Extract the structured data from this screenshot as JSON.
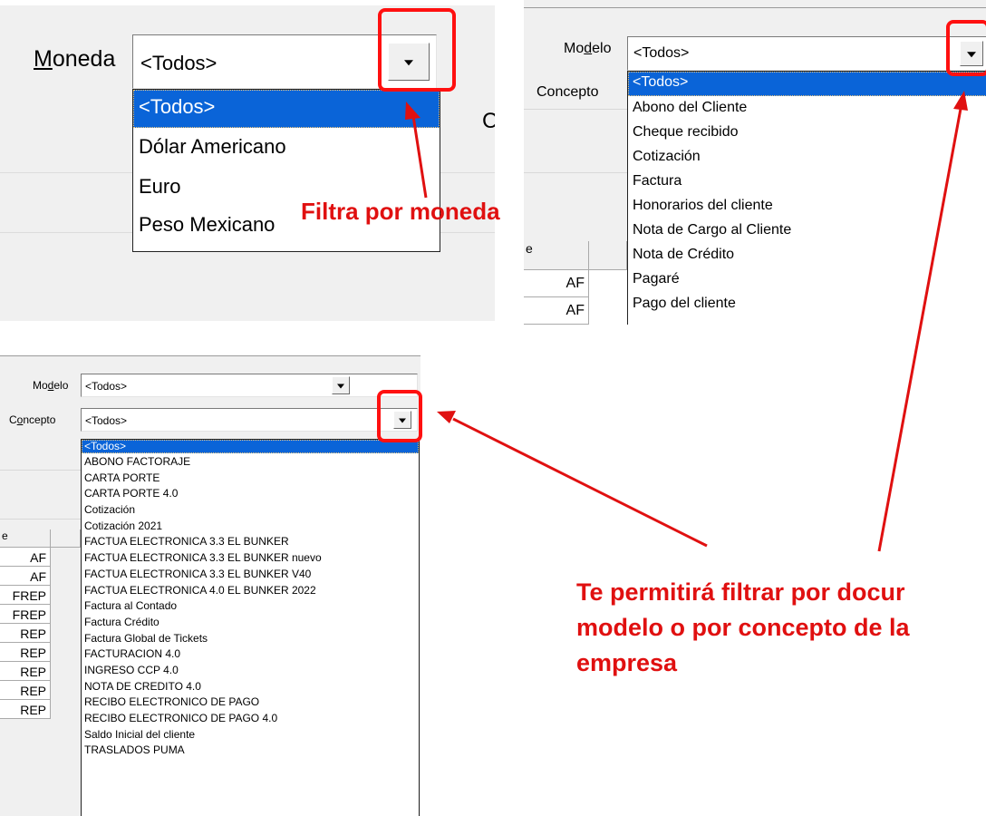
{
  "panel1": {
    "label_prefix": "M",
    "label_rest": "oneda",
    "selected": "<Todos>",
    "options": [
      "<Todos>",
      "Dólar Americano",
      "Euro",
      "Peso Mexicano"
    ],
    "clipped_text": "C",
    "annotation": "Filtra por moneda"
  },
  "panel2": {
    "modelo_pre": "Mo",
    "modelo_u": "d",
    "modelo_post": "elo",
    "modelo_value": "<Todos>",
    "concepto_label": "Concepto",
    "options": [
      "<Todos>",
      "Abono del Cliente",
      "Cheque recibido",
      "Cotización",
      "Factura",
      "Honorarios del cliente",
      "Nota de Cargo al Cliente",
      "Nota de Crédito",
      "Pagaré",
      "Pago del cliente"
    ],
    "grid_header_clip": "e",
    "grid_rows": [
      "AF",
      "AF"
    ]
  },
  "panel3": {
    "modelo_pre": "Mo",
    "modelo_u": "d",
    "modelo_post": "elo",
    "modelo_value": "<Todos>",
    "concepto_pre": "C",
    "concepto_u": "o",
    "concepto_post": "ncepto",
    "concepto_value": "<Todos>",
    "options": [
      "<Todos>",
      "ABONO FACTORAJE",
      "CARTA PORTE",
      "CARTA PORTE 4.0",
      "Cotización",
      "Cotización 2021",
      "FACTUA ELECTRONICA 3.3 EL BUNKER",
      "FACTUA ELECTRONICA 3.3 EL BUNKER nuevo",
      "FACTUA ELECTRONICA 3.3 EL BUNKER V40",
      "FACTUA ELECTRONICA 4.0 EL BUNKER 2022",
      "Factura al Contado",
      "Factura Crédito",
      "Factura Global de Tickets",
      "FACTURACION 4.0",
      "INGRESO CCP 4.0",
      "NOTA DE CREDITO 4.0",
      "RECIBO ELECTRONICO DE PAGO",
      "RECIBO ELECTRONICO DE PAGO 4.0",
      "Saldo Inicial del cliente",
      "TRASLADOS PUMA"
    ],
    "grid_header_clip": "e",
    "grid_rows": [
      "AF",
      "AF",
      "FREP",
      "FREP",
      "REP",
      "REP",
      "REP",
      "REP",
      "REP"
    ]
  },
  "annotation_main": [
    "Te permitirá filtrar por docur",
    "modelo o por concepto de la",
    "empresa"
  ],
  "colors": {
    "annotation_red": "#e01010",
    "selection_blue": "#0a64d8",
    "panel_gray": "#f0f0f0"
  }
}
